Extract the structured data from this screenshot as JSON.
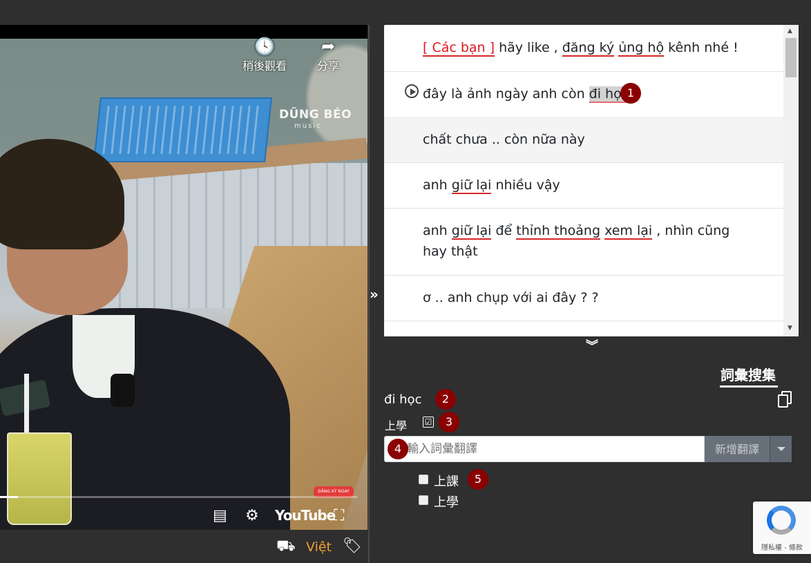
{
  "video": {
    "watch_later_label": "稍後觀看",
    "share_label": "分享",
    "brand": "DŨNG BÉO",
    "brand_sub": "music",
    "subscribe_badge": "ĐĂNG KÝ NGAY",
    "youtube_logo": "YouTube",
    "progress": 0.05
  },
  "language": {
    "current": "Việt",
    "accent_color": "#f2a033"
  },
  "subtitles": [
    {
      "segments": [
        {
          "t": "[ Các bạn ]",
          "style": "u-red"
        },
        {
          "t": " hãy like , ",
          "style": ""
        },
        {
          "t": "đăng ký",
          "style": "u"
        },
        {
          "t": " ",
          "style": ""
        },
        {
          "t": "ủng hộ",
          "style": "u"
        },
        {
          "t": " kênh nhé !",
          "style": ""
        }
      ]
    },
    {
      "segments": [
        {
          "t": "đây là ảnh ngày anh còn ",
          "style": ""
        },
        {
          "t": "đi học",
          "style": "sel"
        }
      ],
      "playing": true
    },
    {
      "segments": [
        {
          "t": "chất chưa .. còn nữa này",
          "style": ""
        }
      ],
      "highlight": true
    },
    {
      "segments": [
        {
          "t": "anh ",
          "style": ""
        },
        {
          "t": "giữ lại",
          "style": "u"
        },
        {
          "t": " nhiều vậy",
          "style": ""
        }
      ]
    },
    {
      "segments": [
        {
          "t": "anh ",
          "style": ""
        },
        {
          "t": "giữ lại",
          "style": "u"
        },
        {
          "t": " để ",
          "style": ""
        },
        {
          "t": "thỉnh thoảng",
          "style": "u"
        },
        {
          "t": " ",
          "style": ""
        },
        {
          "t": "xem lại",
          "style": "u"
        },
        {
          "t": " , nhìn cũng hay thật",
          "style": ""
        }
      ]
    },
    {
      "segments": [
        {
          "t": "ơ .. anh chụp với ai đây ? ?",
          "style": ""
        }
      ]
    }
  ],
  "badges": {
    "b1": "1",
    "b2": "2",
    "b3": "3",
    "b4": "4",
    "b5": "5"
  },
  "vocab": {
    "tab_title": "詞彙搜集",
    "word": "đi học",
    "translation": "上學",
    "translation_checked": "☑",
    "input_placeholder": "輸入詞彙翻譯",
    "add_button": "新增翻譯",
    "options": [
      "上課",
      "上學"
    ]
  },
  "recaptcha": {
    "text": "隱私權 - 條款"
  }
}
